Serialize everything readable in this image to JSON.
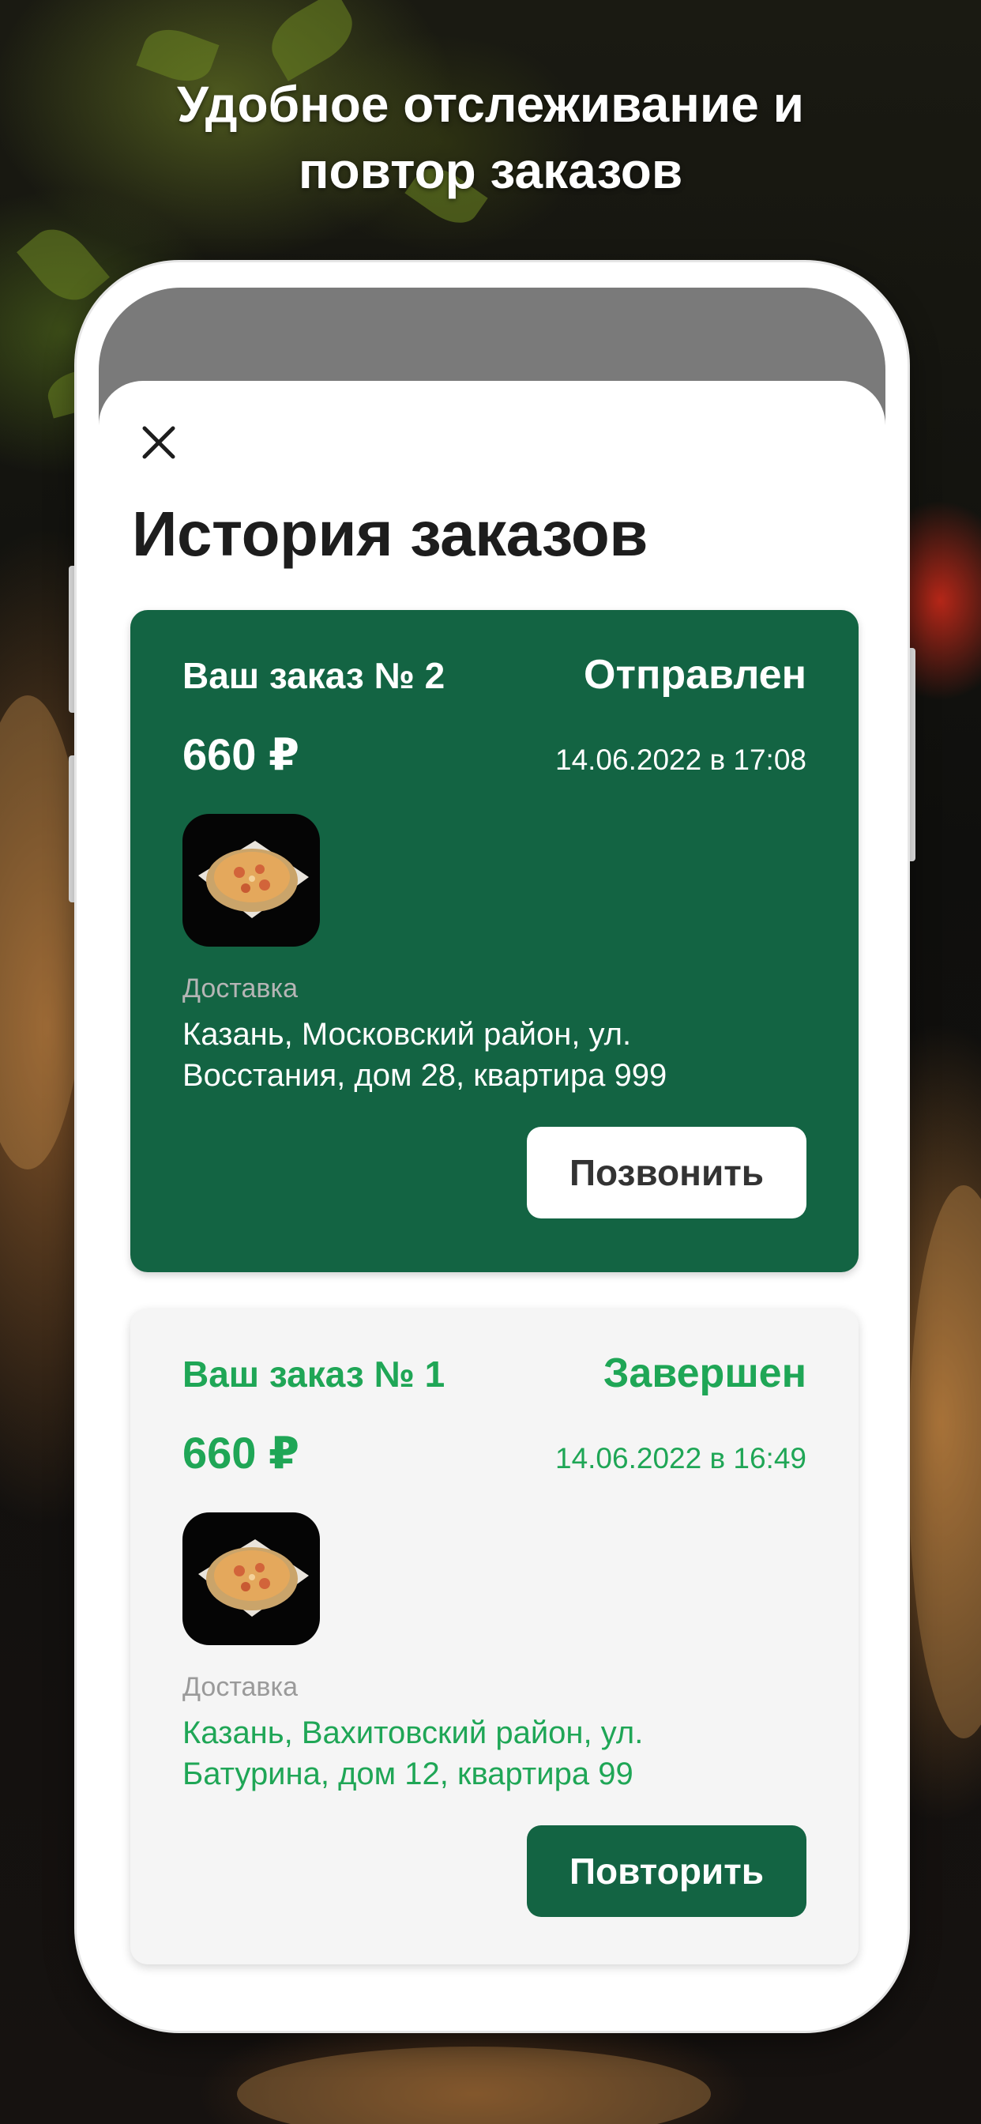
{
  "headline": {
    "line1": "Удобное отслеживание и",
    "line2": "повтор заказов"
  },
  "screen": {
    "title": "История заказов",
    "close_icon": "close-icon"
  },
  "orders": [
    {
      "number_label": "Ваш заказ № 2",
      "status": "Отправлен",
      "price": "660 ₽",
      "date": "14.06.2022 в 17:08",
      "thumbnail_icon": "pizza-photo",
      "delivery_label": "Доставка",
      "address_line1": "Казань, Московский район, ул.",
      "address_line2": "Восстания, дом 28, квартира 999",
      "action_label": "Позвонить",
      "card_color": "#136443"
    },
    {
      "number_label": "Ваш заказ № 1",
      "status": "Завершен",
      "price": "660 ₽",
      "date": "14.06.2022 в 16:49",
      "thumbnail_icon": "pizza-photo",
      "delivery_label": "Доставка",
      "address_line1": "Казань, Вахитовский район, ул.",
      "address_line2": "Батурина, дом 12, квартира 99",
      "action_label": "Повторить",
      "accent_color": "#1fa656"
    }
  ]
}
